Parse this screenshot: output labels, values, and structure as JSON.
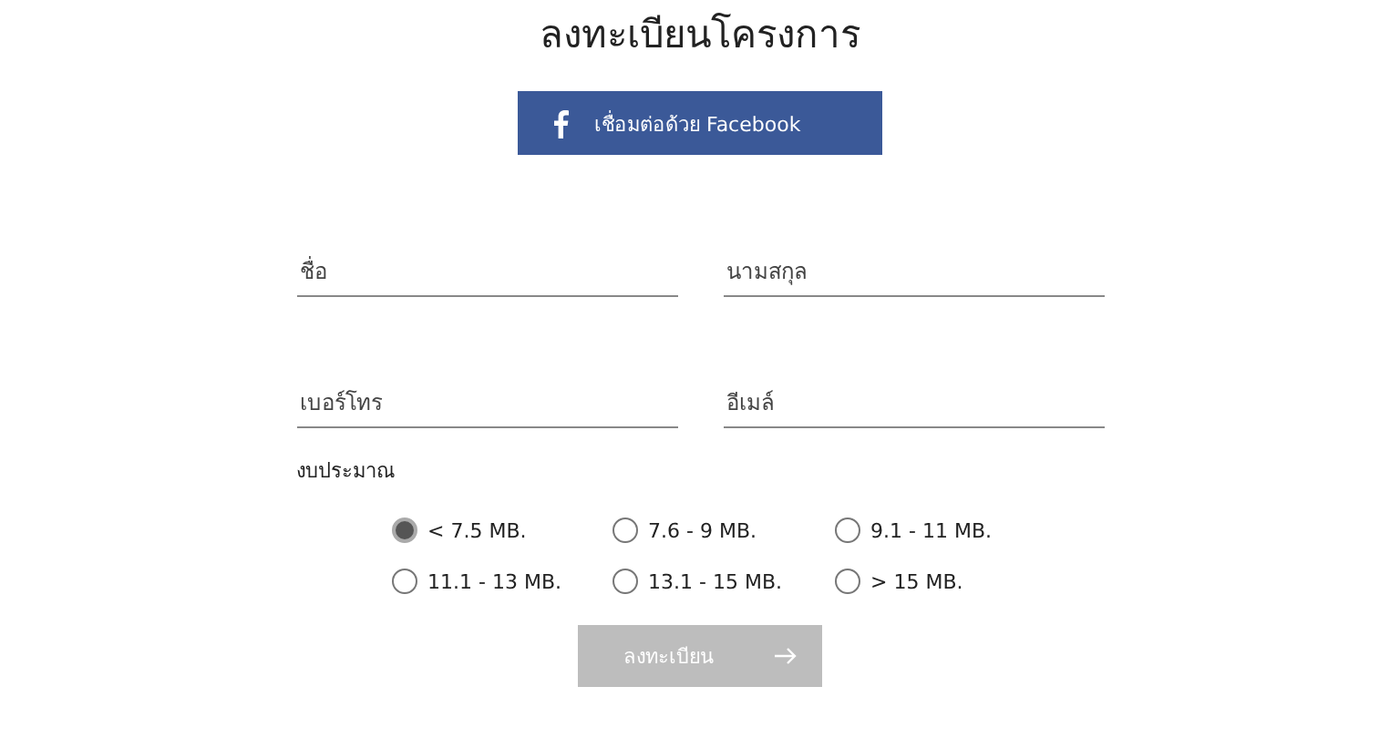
{
  "title": "ลงทะเบียนโครงการ",
  "facebook_button": {
    "label": "เชื่อมต่อด้วย Facebook"
  },
  "fields": [
    {
      "placeholder": "ชื่อ"
    },
    {
      "placeholder": "นามสกุล"
    },
    {
      "placeholder": "เบอร์โทร"
    },
    {
      "placeholder": "อีเมล์"
    }
  ],
  "budget": {
    "label": "งบประมาณ",
    "options": [
      {
        "label": "< 7.5 MB.",
        "selected": true
      },
      {
        "label": "7.6 - 9 MB.",
        "selected": false
      },
      {
        "label": "9.1 - 11 MB.",
        "selected": false
      },
      {
        "label": "11.1 - 13 MB.",
        "selected": false
      },
      {
        "label": "13.1 - 15 MB.",
        "selected": false
      },
      {
        "label": "> 15 MB.",
        "selected": false
      }
    ]
  },
  "submit_button": {
    "label": "ลงทะเบียน",
    "disabled": true
  }
}
